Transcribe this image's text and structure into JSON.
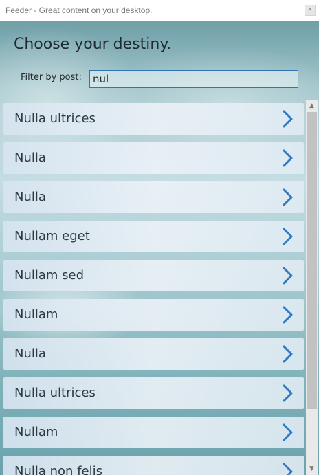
{
  "window": {
    "title": "Feeder - Great content on your desktop.",
    "close_glyph": "×"
  },
  "heading": "Choose your destiny.",
  "filter": {
    "label": "Filter by post:",
    "value": "nul"
  },
  "posts": [
    {
      "title": "Nulla ultrices"
    },
    {
      "title": "Nulla"
    },
    {
      "title": "Nulla"
    },
    {
      "title": "Nullam eget"
    },
    {
      "title": "Nullam sed"
    },
    {
      "title": "Nullam"
    },
    {
      "title": "Nulla"
    },
    {
      "title": "Nulla ultrices"
    },
    {
      "title": "Nullam"
    },
    {
      "title": "Nulla non felis"
    }
  ],
  "scrollbar": {
    "up_glyph": "▲",
    "down_glyph": "▼"
  },
  "colors": {
    "accent": "#2f74b5",
    "chevron": "#2f78c4"
  },
  "icons": {
    "row_chevron": "chevron-right-icon",
    "close": "close-icon"
  }
}
